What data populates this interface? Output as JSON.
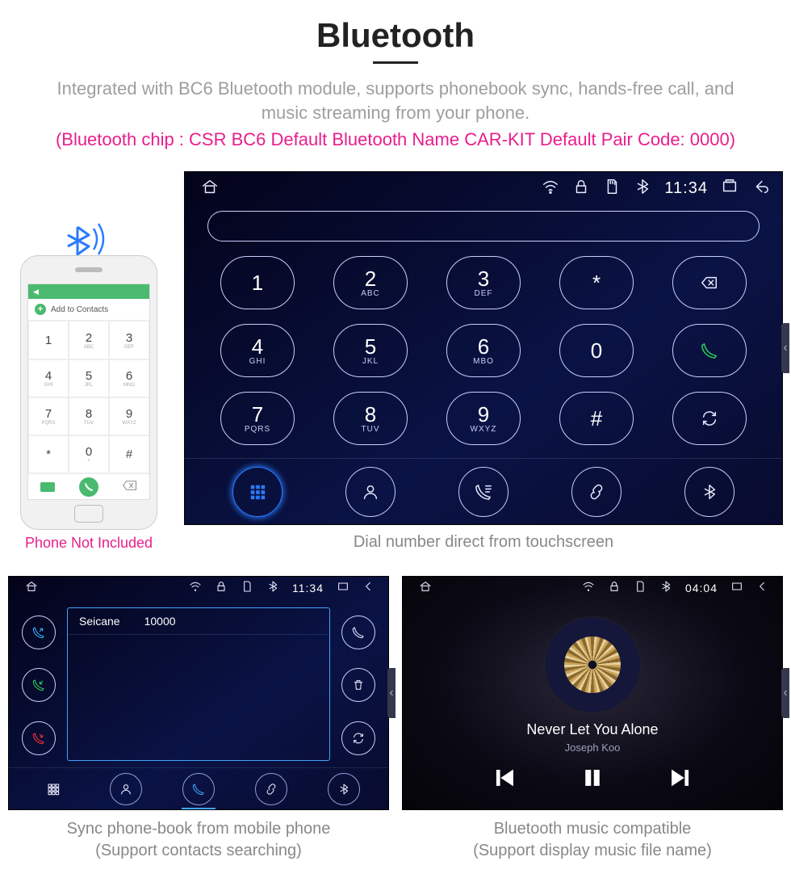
{
  "header": {
    "title": "Bluetooth",
    "desc": "Integrated with BC6 Bluetooth module, supports phonebook sync, hands-free call, and music streaming from your phone.",
    "pink": "(Bluetooth chip : CSR BC6     Default Bluetooth Name CAR-KIT     Default Pair Code: 0000)"
  },
  "phone": {
    "not_included": "Phone Not Included",
    "add_contacts": "Add to Contacts",
    "keys": [
      {
        "n": "1",
        "s": ""
      },
      {
        "n": "2",
        "s": "ABC"
      },
      {
        "n": "3",
        "s": "DEF"
      },
      {
        "n": "4",
        "s": "GHI"
      },
      {
        "n": "5",
        "s": "JKL"
      },
      {
        "n": "6",
        "s": "MNO"
      },
      {
        "n": "7",
        "s": "PQRS"
      },
      {
        "n": "8",
        "s": "TUV"
      },
      {
        "n": "9",
        "s": "WXYZ"
      },
      {
        "n": "*",
        "s": ""
      },
      {
        "n": "0",
        "s": "+"
      },
      {
        "n": "#",
        "s": ""
      }
    ]
  },
  "dialer": {
    "clock": "11:34",
    "keys": [
      {
        "n": "1",
        "s": ""
      },
      {
        "n": "2",
        "s": "ABC"
      },
      {
        "n": "3",
        "s": "DEF"
      },
      {
        "n": "*",
        "s": ""
      },
      {
        "icon": "backspace"
      },
      {
        "n": "4",
        "s": "GHI"
      },
      {
        "n": "5",
        "s": "JKL"
      },
      {
        "n": "6",
        "s": "MBO"
      },
      {
        "n": "0",
        "s": ""
      },
      {
        "icon": "call"
      },
      {
        "n": "7",
        "s": "PQRS"
      },
      {
        "n": "8",
        "s": "TUV"
      },
      {
        "n": "9",
        "s": "WXYZ"
      },
      {
        "n": "#",
        "s": ""
      },
      {
        "icon": "swap"
      }
    ],
    "caption": "Dial number direct from touchscreen"
  },
  "phonebook": {
    "clock": "11:34",
    "contact_name": "Seicane",
    "contact_number": "10000",
    "caption_l1": "Sync phone-book from mobile phone",
    "caption_l2": "(Support contacts searching)"
  },
  "music": {
    "clock": "04:04",
    "title": "Never Let You Alone",
    "artist": "Joseph Koo",
    "caption_l1": "Bluetooth music compatible",
    "caption_l2": "(Support display music file name)"
  }
}
